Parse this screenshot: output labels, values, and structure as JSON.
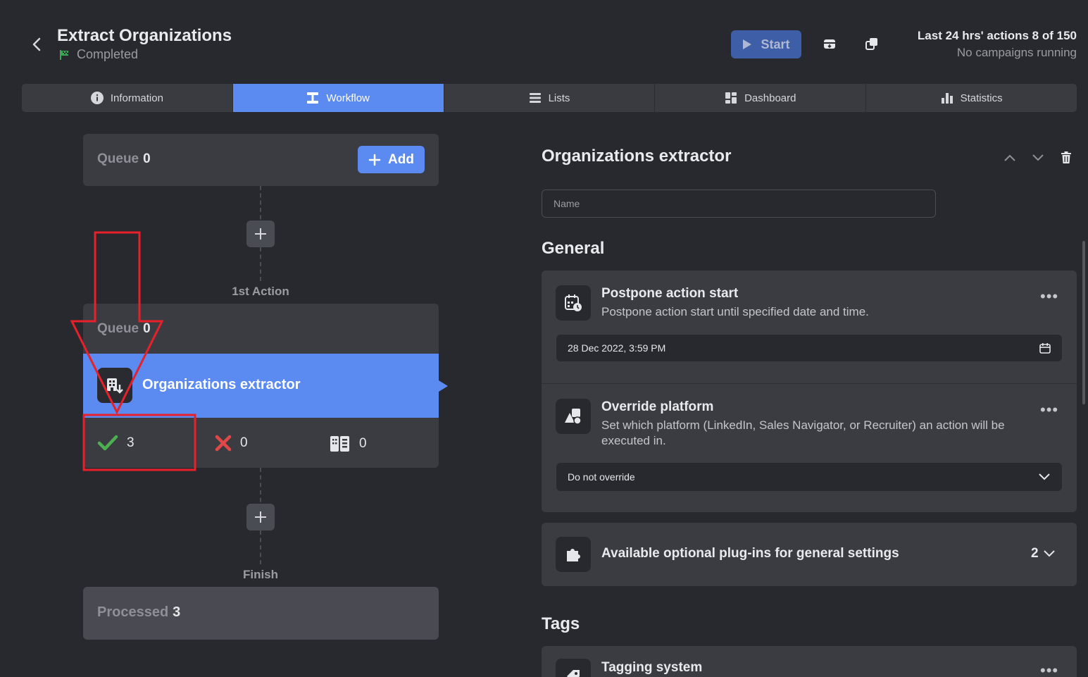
{
  "header": {
    "title": "Extract Organizations",
    "status": "Completed",
    "start_label": "Start",
    "usage_line": "Last 24 hrs' actions 8 of 150",
    "campaigns_line": "No campaigns running"
  },
  "tabs": [
    {
      "label": "Information",
      "icon": "info-icon"
    },
    {
      "label": "Workflow",
      "icon": "workflow-icon",
      "active": true
    },
    {
      "label": "Lists",
      "icon": "list-icon"
    },
    {
      "label": "Dashboard",
      "icon": "dashboard-icon"
    },
    {
      "label": "Statistics",
      "icon": "statistics-icon"
    }
  ],
  "workflow": {
    "queue": {
      "label": "Queue",
      "count": "0"
    },
    "add_label": "Add",
    "step1_label": "1st Action",
    "action": {
      "queue_label": "Queue",
      "queue_count": "0",
      "name": "Organizations extractor",
      "success_count": "3",
      "fail_count": "0",
      "other_count": "0"
    },
    "finish_label": "Finish",
    "processed": {
      "label": "Processed",
      "count": "3"
    }
  },
  "panel": {
    "title": "Organizations extractor",
    "name_placeholder": "Name",
    "general_heading": "General",
    "postpone": {
      "title": "Postpone action start",
      "desc": "Postpone action start until specified date and time.",
      "value": "28 Dec 2022, 3:59 PM"
    },
    "override": {
      "title": "Override platform",
      "desc": "Set which platform (LinkedIn, Sales Navigator, or Recruiter) an action will be executed in.",
      "value": "Do not override"
    },
    "plugins": {
      "title": "Available optional plug-ins for general settings",
      "count": "2"
    },
    "tags_heading": "Tags",
    "tagging": {
      "title": "Tagging system"
    }
  },
  "colors": {
    "accent": "#5b8af0",
    "background": "#28292e",
    "card": "#3b3c42",
    "success": "#4caf50",
    "fail": "#e04848",
    "annotation": "#e8202a",
    "status_flag": "#3aa655"
  }
}
